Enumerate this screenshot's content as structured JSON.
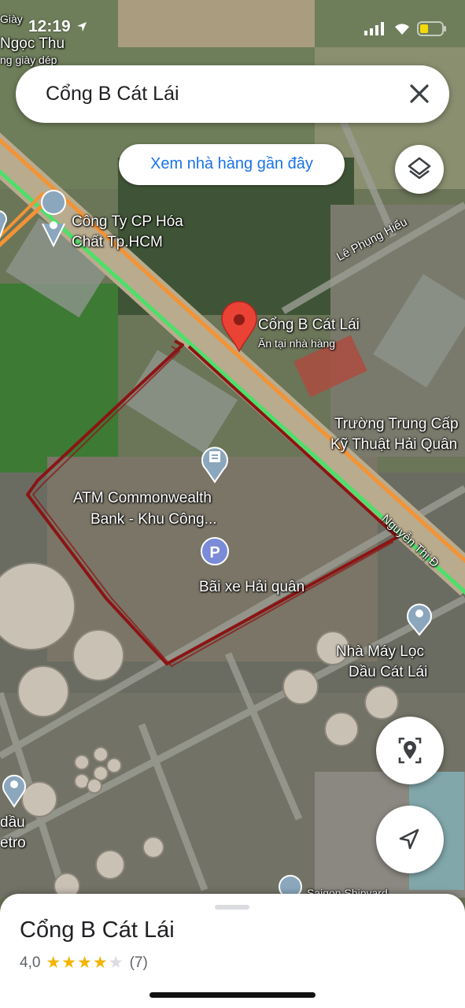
{
  "status_bar": {
    "time": "12:19"
  },
  "search": {
    "query": "Cổng B Cát Lái"
  },
  "chip": {
    "label": "Xem nhà hàng gần đây"
  },
  "pins": {
    "selected": {
      "title": "Cổng B Cát Lái",
      "subtitle": "Ăn tại nhà hàng"
    },
    "company": {
      "line1": "Công Ty CP Hóa",
      "line2": "Chất Tp.HCM"
    },
    "atm": {
      "line1": "ATM Commonwealth",
      "line2": "Bank - Khu Công..."
    },
    "parking": {
      "label": "Bãi xe Hải quân",
      "icon_letter": "P"
    },
    "school": {
      "line1": "Trường Trung Cấp",
      "line2": "Kỹ Thuật Hải Quân"
    },
    "refinery": {
      "line1": "Nhà Máy Lọc",
      "line2": "Dầu Cát Lái"
    },
    "left_edge": {
      "line1": "dầu",
      "line2": "etro"
    },
    "bottom": {
      "label": "Saigon Shipyard"
    },
    "top_left": {
      "line1": "Giày",
      "line2": "Ngọc Thu",
      "line3": "ng giày dép"
    }
  },
  "roads": {
    "le_phung_hieu": "Lê Phụng Hiểu",
    "nguyen_thi": "Nguyễn Thị Đ"
  },
  "place": {
    "title": "Cổng B Cát Lái",
    "rating": "4,0",
    "stars_filled": 4,
    "stars_total": 5,
    "reviews": "(7)"
  },
  "colors": {
    "accent_blue": "#1a73e8",
    "pin_red": "#ea4335",
    "traffic_green": "#4ce06a",
    "traffic_orange": "#f29436",
    "boundary_red": "#8b1414",
    "star_gold": "#f4b400"
  },
  "icons": [
    "close-icon",
    "layers-icon",
    "my-location-icon",
    "navigate-icon",
    "place-pin-icon",
    "atm-icon",
    "parking-icon"
  ]
}
